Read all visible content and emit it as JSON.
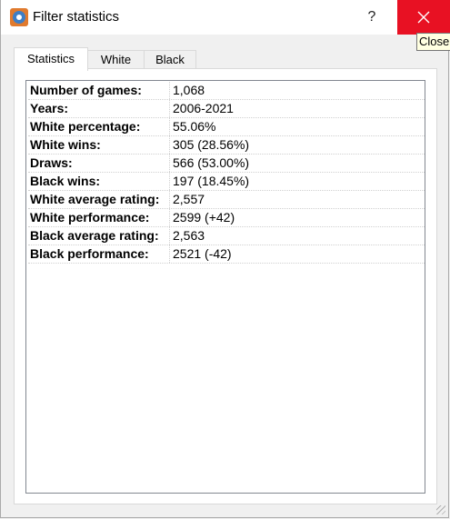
{
  "window": {
    "title": "Filter statistics",
    "help_label": "?",
    "close_tooltip": "Close"
  },
  "tabs": [
    {
      "label": "Statistics",
      "active": true
    },
    {
      "label": "White",
      "active": false
    },
    {
      "label": "Black",
      "active": false
    }
  ],
  "stats": [
    {
      "label": "Number of games:",
      "value": "1,068"
    },
    {
      "label": "Years:",
      "value": "2006-2021"
    },
    {
      "label": "White percentage:",
      "value": "55.06%"
    },
    {
      "label": "White wins:",
      "value": "305 (28.56%)"
    },
    {
      "label": "Draws:",
      "value": "566 (53.00%)"
    },
    {
      "label": "Black wins:",
      "value": "197 (18.45%)"
    },
    {
      "label": "White average rating:",
      "value": "2,557"
    },
    {
      "label": "White performance:",
      "value": "2599 (+42)"
    },
    {
      "label": "Black average rating:",
      "value": "2,563"
    },
    {
      "label": "Black performance:",
      "value": "2521 (-42)"
    }
  ],
  "colors": {
    "close_button": "#e81123",
    "tooltip_bg": "#ffffe1",
    "app_icon_orange": "#e07a2e",
    "app_icon_blue": "#3d7ec6"
  },
  "icons": {
    "app": "app-icon",
    "close": "close-icon"
  }
}
